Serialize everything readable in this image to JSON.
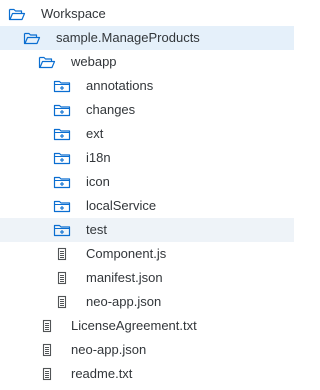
{
  "tree": [
    {
      "label": "Workspace",
      "icon": "folder-open-icon",
      "level": 0,
      "state": "normal"
    },
    {
      "label": "sample.ManageProducts",
      "icon": "folder-open-icon",
      "level": 1,
      "state": "selected"
    },
    {
      "label": "webapp",
      "icon": "folder-open-icon",
      "level": 2,
      "state": "normal"
    },
    {
      "label": "annotations",
      "icon": "folder-closed-icon",
      "level": 3,
      "state": "normal"
    },
    {
      "label": "changes",
      "icon": "folder-closed-icon",
      "level": 3,
      "state": "normal"
    },
    {
      "label": "ext",
      "icon": "folder-closed-icon",
      "level": 3,
      "state": "normal"
    },
    {
      "label": "i18n",
      "icon": "folder-closed-icon",
      "level": 3,
      "state": "normal"
    },
    {
      "label": "icon",
      "icon": "folder-closed-icon",
      "level": 3,
      "state": "normal"
    },
    {
      "label": "localService",
      "icon": "folder-closed-icon",
      "level": 3,
      "state": "normal"
    },
    {
      "label": "test",
      "icon": "folder-closed-icon",
      "level": 3,
      "state": "hover"
    },
    {
      "label": "Component.js",
      "icon": "file-icon",
      "level": 3,
      "state": "normal"
    },
    {
      "label": "manifest.json",
      "icon": "file-icon",
      "level": 3,
      "state": "normal"
    },
    {
      "label": "neo-app.json",
      "icon": "file-icon",
      "level": 3,
      "state": "normal"
    },
    {
      "label": "LicenseAgreement.txt",
      "icon": "file-icon",
      "level": 2,
      "state": "normal"
    },
    {
      "label": "neo-app.json",
      "icon": "file-icon",
      "level": 2,
      "state": "normal"
    },
    {
      "label": "readme.txt",
      "icon": "file-icon",
      "level": 2,
      "state": "normal"
    }
  ],
  "colors": {
    "icon": "#0a6ed1",
    "file_icon": "#515456",
    "selected_bg": "#e5f0fa",
    "hover_bg": "#eef3f8",
    "text": "#32363a"
  }
}
